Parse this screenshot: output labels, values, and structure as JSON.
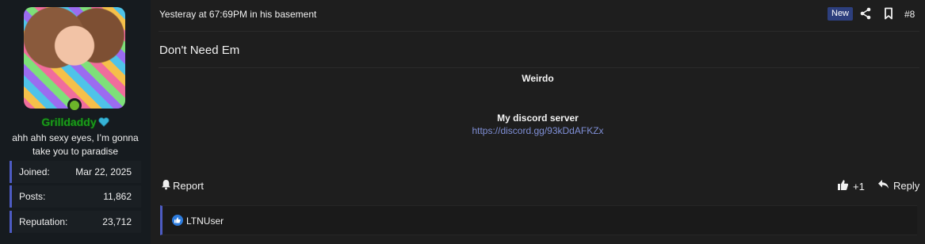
{
  "user": {
    "username": "Grilldaddy",
    "title": "ahh ahh sexy eyes, I’m gonna take you to paradise",
    "stats": [
      {
        "label": "Joined:",
        "value": "Mar 22, 2025"
      },
      {
        "label": "Posts:",
        "value": "11,862"
      },
      {
        "label": "Reputation:",
        "value": "23,712"
      }
    ],
    "online_color": "#6cb52a",
    "username_color": "#1a9c1a"
  },
  "post": {
    "meta": "Yesteray at 67:69PM in his basement",
    "badge": "New",
    "number": "#8",
    "title": "Don't Need Em",
    "body_heading": "Weirdo",
    "signature_label": "My discord server",
    "signature_link": "https://discord.gg/93kDdAFKZx"
  },
  "actions": {
    "report": "Report",
    "like_count": "+1",
    "reply": "Reply"
  },
  "reactions": {
    "users": "LTNUser"
  },
  "colors": {
    "accent": "#4d5bc2",
    "link": "#7f8fd6",
    "badge_bg": "#2d3f7d"
  }
}
